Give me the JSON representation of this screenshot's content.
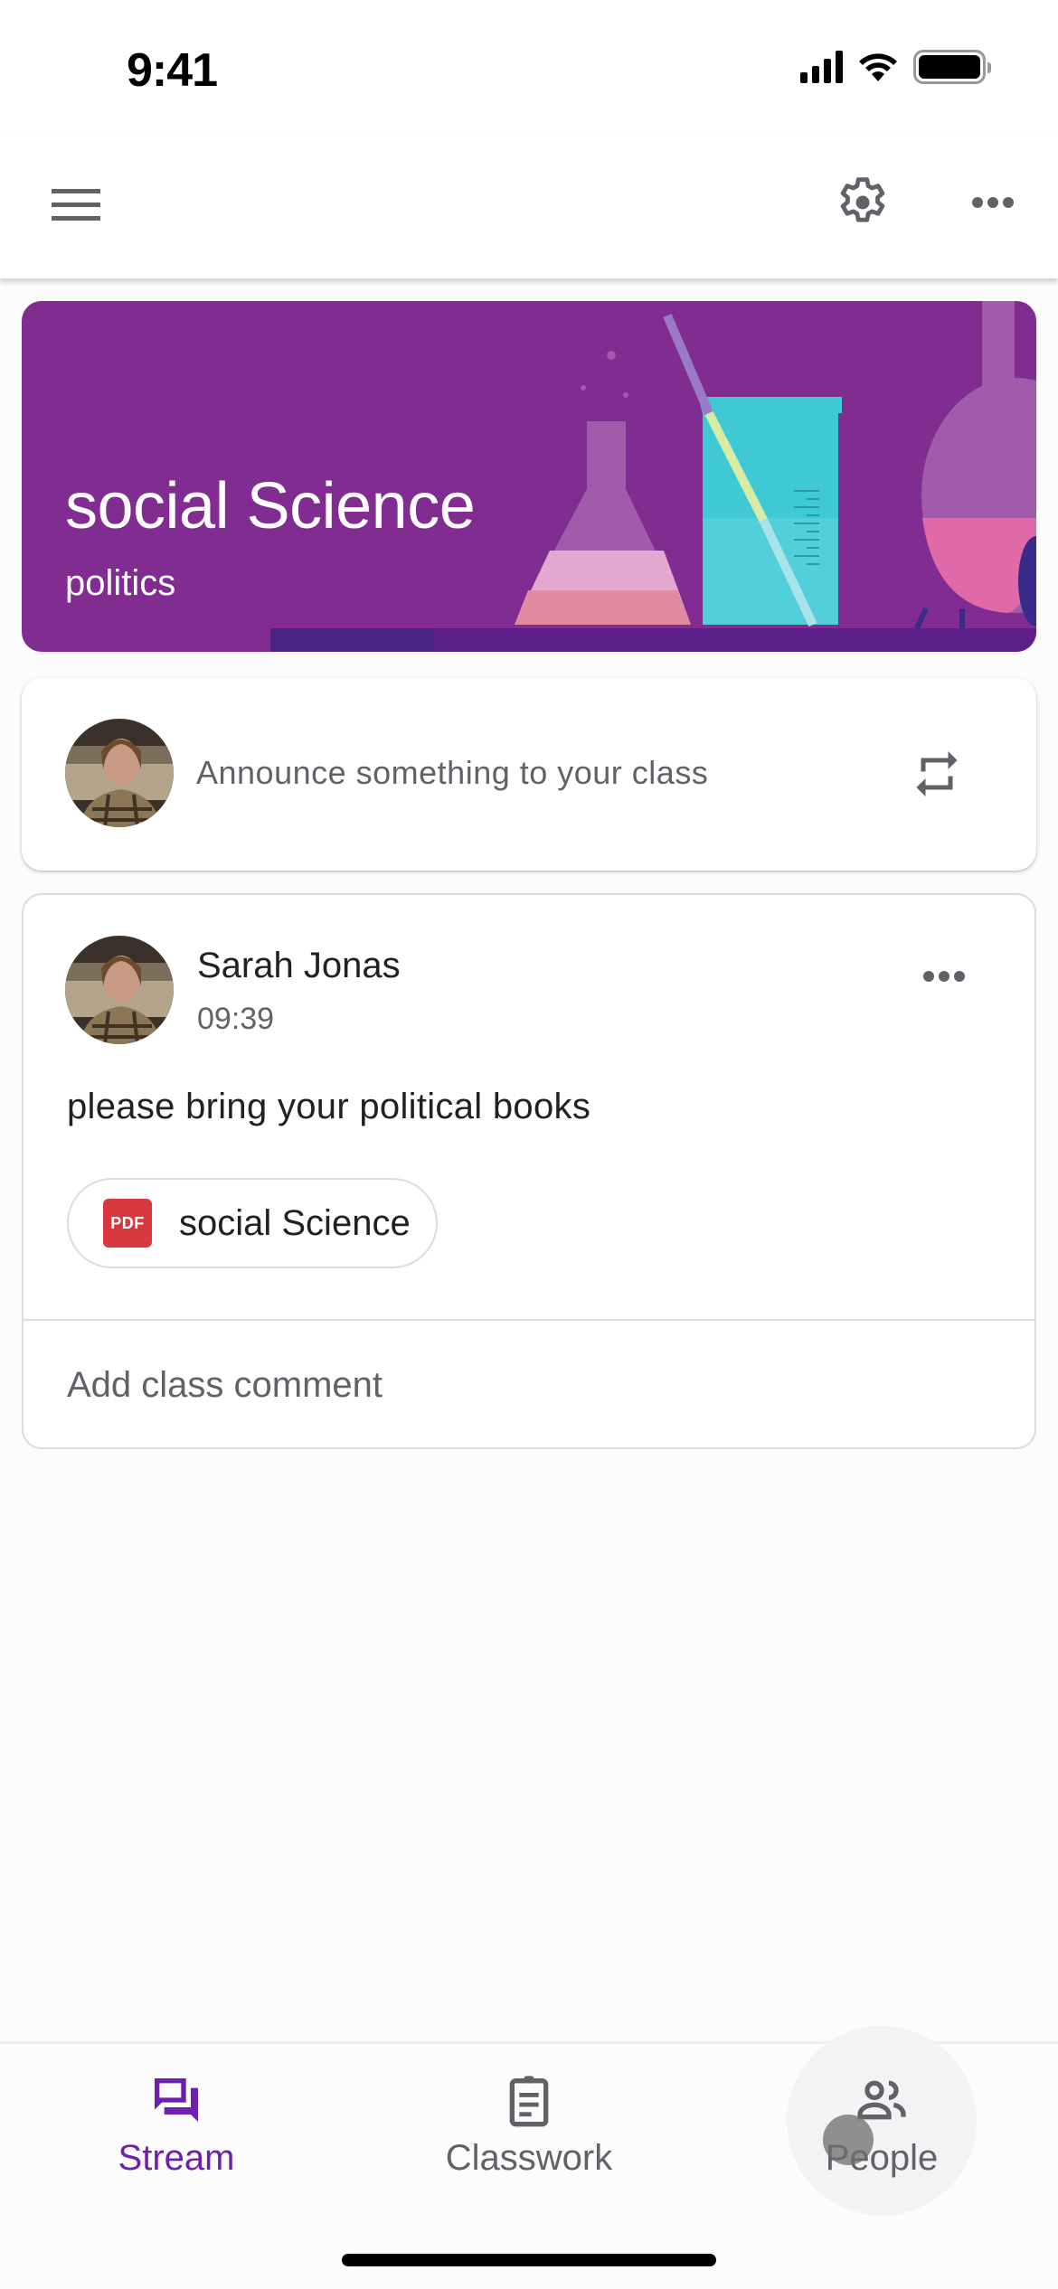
{
  "status_bar": {
    "time": "9:41",
    "icons": [
      "cellular-signal-icon",
      "wifi-icon",
      "battery-icon"
    ]
  },
  "app_bar": {
    "left_icon": "menu-icon",
    "right_icons": [
      "settings-gear-icon",
      "more-horizontal-icon"
    ]
  },
  "banner": {
    "class_name": "social Science",
    "section": "politics",
    "theme_color": "#812c91",
    "illustration": "science-lab-glassware"
  },
  "announce": {
    "placeholder": "Announce something to your class",
    "action_icon": "repost-icon"
  },
  "post": {
    "author": "Sarah Jonas",
    "time": "09:39",
    "body": "please bring your political books",
    "attachment": {
      "type": "PDF",
      "title": "social Science"
    },
    "comment_placeholder": "Add class comment"
  },
  "bottom_nav": {
    "active_color": "#6e1fae",
    "tabs": [
      {
        "label": "Stream",
        "icon": "stream-icon",
        "active": true
      },
      {
        "label": "Classwork",
        "icon": "clipboard-icon",
        "active": false
      },
      {
        "label": "People",
        "icon": "people-icon",
        "active": false
      }
    ]
  }
}
